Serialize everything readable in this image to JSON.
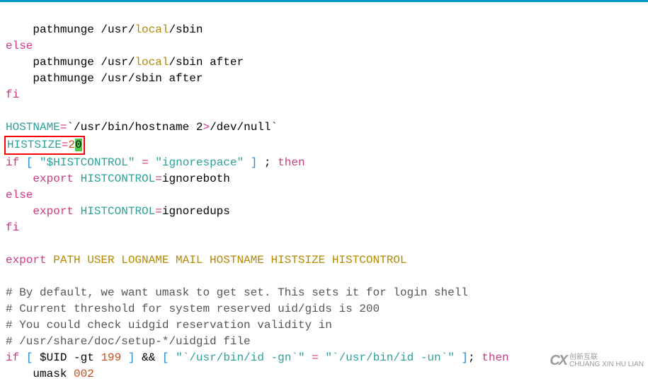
{
  "code": {
    "l1_a": "    pathmunge /usr/",
    "l1_b": "local",
    "l1_c": "/sbin",
    "l2": "else",
    "l3_a": "    pathmunge /usr/",
    "l3_b": "local",
    "l3_c": "/sbin after",
    "l4": "    pathmunge /usr/sbin after",
    "l5": "fi",
    "l6_var": "HOSTNAME",
    "l6_eq": "=",
    "l6_bt1": "`",
    "l6_path": "/usr/bin/hostname 2",
    "l6_gt": ">",
    "l6_rest": "/dev/null",
    "l6_bt2": "`",
    "l7_var": "HISTSIZE",
    "l7_eq": "=",
    "l7_num1": "2",
    "l7_cursor": "0",
    "l8_if": "if",
    "l8_sp1": " ",
    "l8_lb": "[",
    "l8_sp2": " ",
    "l8_str1": "\"$HISTCONTROL\"",
    "l8_sp3": " ",
    "l8_eq": "=",
    "l8_sp4": " ",
    "l8_str2": "\"ignorespace\"",
    "l8_sp5": " ",
    "l8_rb": "]",
    "l8_semi": " ; ",
    "l8_then": "then",
    "l9_a": "    ",
    "l9_export": "export",
    "l9_sp": " ",
    "l9_var": "HISTCONTROL",
    "l9_eq": "=",
    "l9_val": "ignoreboth",
    "l10": "else",
    "l11_a": "    ",
    "l11_export": "export",
    "l11_sp": " ",
    "l11_var": "HISTCONTROL",
    "l11_eq": "=",
    "l11_val": "ignoredups",
    "l12": "fi",
    "l13_export": "export",
    "l13_list": " PATH USER LOGNAME MAIL HOSTNAME HISTSIZE HISTCONTROL",
    "l14": "# By default, we want umask to get set. This sets it for login shell",
    "l15": "# Current threshold for system reserved uid/gids is 200",
    "l16": "# You could check uidgid reservation validity in",
    "l17": "# /usr/share/doc/setup-*/uidgid file",
    "l18_if": "if",
    "l18_sp1": " ",
    "l18_lb": "[",
    "l18_sp2": " ",
    "l18_uid": "$UID",
    "l18_gt": " -gt ",
    "l18_n": "199",
    "l18_sp3": " ",
    "l18_rb": "]",
    "l18_amp": " && ",
    "l18_lb2": "[",
    "l18_sp4": " ",
    "l18_str1": "\"`/usr/bin/id -gn`\"",
    "l18_sp5": " ",
    "l18_eq": "=",
    "l18_sp6": " ",
    "l18_str2": "\"`/usr/bin/id -un`\"",
    "l18_sp7": " ",
    "l18_rb2": "]",
    "l18_semi": "; ",
    "l18_then": "then",
    "l19_a": "    umask ",
    "l19_n": "002"
  },
  "watermark": {
    "logo": "CX",
    "line1": "创新互联",
    "line2": "CHUANG XIN HU LIAN"
  }
}
